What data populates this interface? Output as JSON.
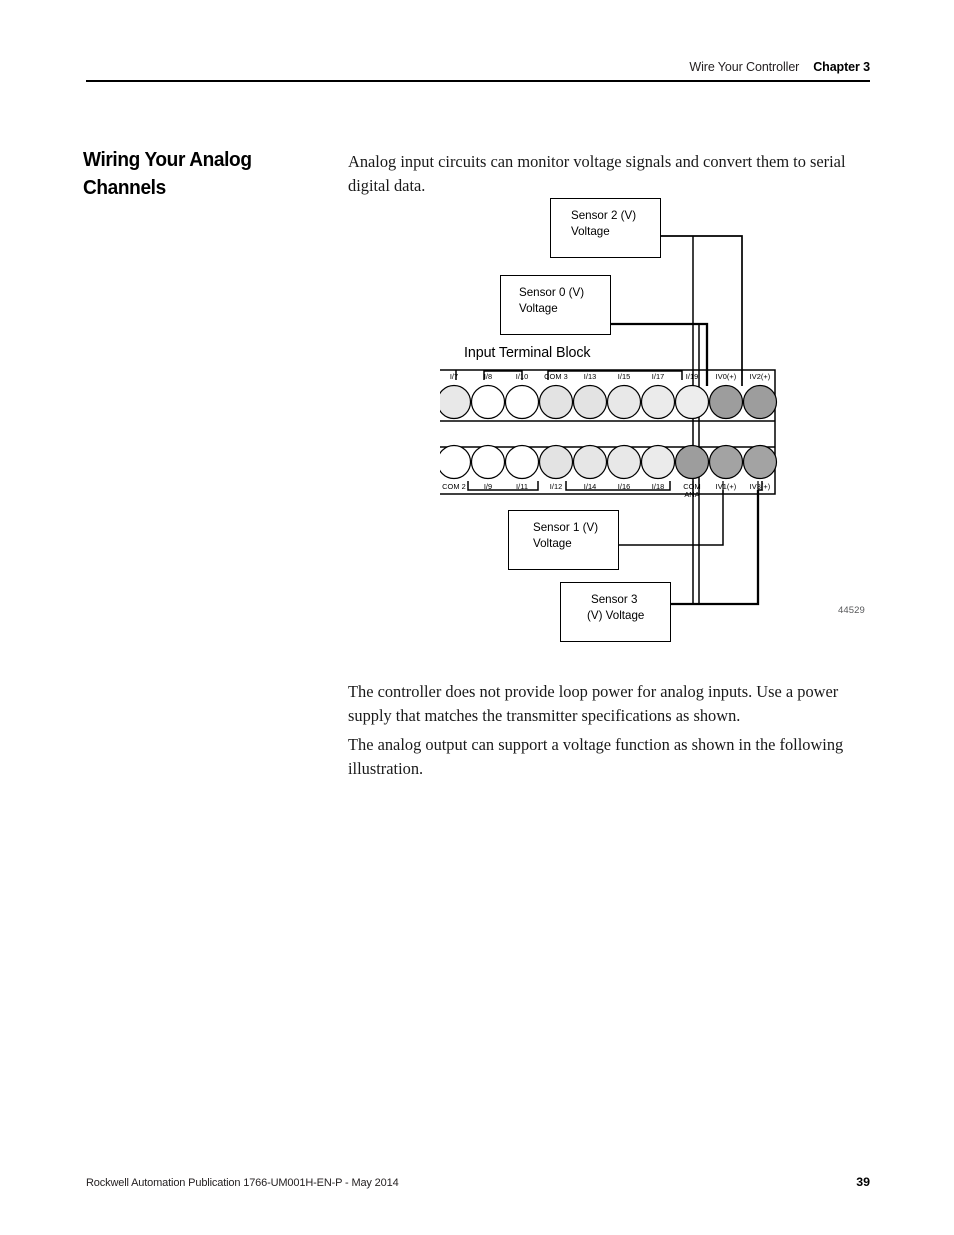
{
  "header": {
    "section_title": "Wire Your Controller",
    "chapter": "Chapter 3"
  },
  "section": {
    "heading_line1": "Wiring Your Analog",
    "heading_line2": "Channels"
  },
  "body": {
    "intro": "Analog input circuits can monitor voltage signals and convert them to serial digital data.",
    "loop_power": "The controller does not provide loop power for analog inputs. Use a power supply that matches the transmitter specifications as shown.",
    "analog_output": "The analog output can support a voltage function as shown in the following illustration."
  },
  "figure": {
    "id": "44529",
    "terminal_block_title": "Input Terminal Block",
    "sensors": [
      {
        "name": "sensor-2",
        "line1": "Sensor 2 (V)",
        "line2": "Voltage",
        "connects_to": "IV2(+)"
      },
      {
        "name": "sensor-0",
        "line1": "Sensor 0 (V)",
        "line2": "Voltage",
        "connects_to": "IV0(+)"
      },
      {
        "name": "sensor-1",
        "line1": "Sensor 1 (V)",
        "line2": "Voltage",
        "connects_to": "IV1(+)"
      },
      {
        "name": "sensor-3",
        "line1": "Sensor 3",
        "line2": "(V) Voltage",
        "connects_to": "IV3(+)"
      }
    ],
    "terminals_top": [
      {
        "label": "I/7",
        "fill": "#e8e8e8",
        "clipped": true
      },
      {
        "label": "I/8",
        "fill": "#ffffff"
      },
      {
        "label": "I/10",
        "fill": "#ffffff"
      },
      {
        "label": "COM 3",
        "fill": "#e3e3e3"
      },
      {
        "label": "I/13",
        "fill": "#e3e3e3"
      },
      {
        "label": "I/15",
        "fill": "#e8e8e8"
      },
      {
        "label": "I/17",
        "fill": "#ebebeb"
      },
      {
        "label": "I/19",
        "fill": "#ededed"
      },
      {
        "label": "IV0(+)",
        "fill": "#9d9d9d"
      },
      {
        "label": "IV2(+)",
        "fill": "#9d9d9d"
      }
    ],
    "terminals_bottom": [
      {
        "label": "COM 2",
        "fill": "#ffffff"
      },
      {
        "label": "I/9",
        "fill": "#ffffff"
      },
      {
        "label": "I/11",
        "fill": "#ffffff"
      },
      {
        "label": "I/12",
        "fill": "#e3e3e3"
      },
      {
        "label": "I/14",
        "fill": "#e6e6e6"
      },
      {
        "label": "I/16",
        "fill": "#e8e8e8"
      },
      {
        "label": "I/18",
        "fill": "#ebebeb"
      },
      {
        "label": "COM\nANA",
        "fill": "#9d9d9d"
      },
      {
        "label": "IV1(+)",
        "fill": "#a3a3a3"
      },
      {
        "label": "IV3(+)",
        "fill": "#a3a3a3"
      }
    ]
  },
  "footer": {
    "publication": "Rockwell Automation Publication 1766-UM001H-EN-P - May 2014",
    "page_number": "39"
  },
  "colors": {
    "rule": "#000000",
    "analog_terminal": "#9d9d9d",
    "digital_terminal": "#e6e6e6",
    "figure_id_text": "#58595b"
  }
}
